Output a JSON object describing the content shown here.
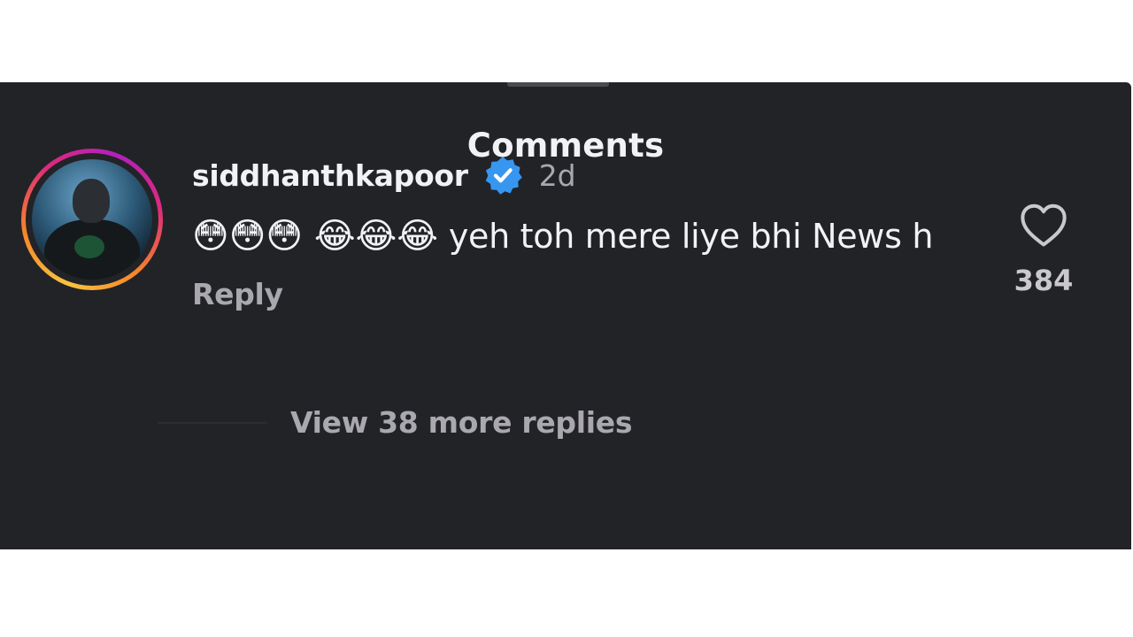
{
  "sheet": {
    "title": "Comments"
  },
  "comment": {
    "username": "siddhanthkapoor",
    "age": "2d",
    "emoji_prefix": "😳😳😳 😂😂😂",
    "text": "yeh toh  mere liye bhi News h",
    "reply_label": "Reply",
    "like_count": "384"
  },
  "replies": {
    "view_more_label": "View 38 more replies"
  },
  "colors": {
    "background": "#222327",
    "text_primary": "#f2f2f4",
    "text_secondary": "#a8a8ae",
    "verified_badge": "#3797f0"
  },
  "icons": {
    "verified": "verified-badge-icon",
    "like": "heart-outline-icon"
  }
}
